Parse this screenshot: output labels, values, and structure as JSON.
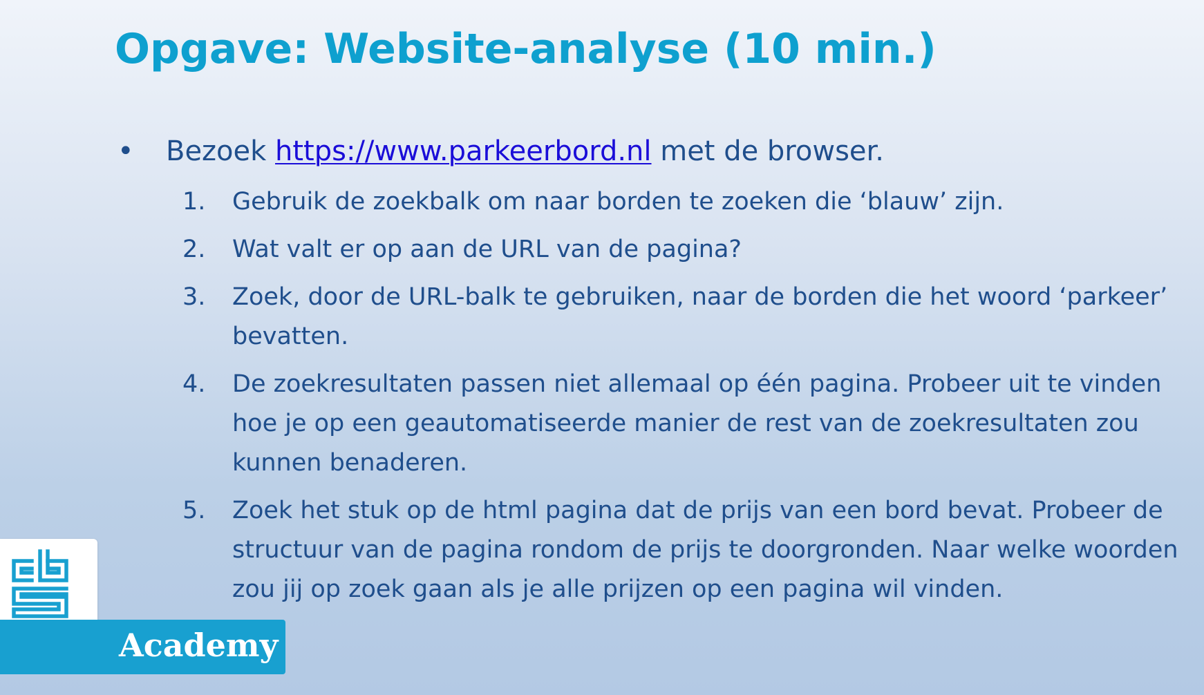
{
  "slide": {
    "title": "Opgave: Website-analyse (10 min.)"
  },
  "bullet": {
    "marker": "•",
    "prefix": "Bezoek ",
    "link": "https://www.parkeerbord.nl",
    "suffix": " met de browser."
  },
  "steps": [
    {
      "number": "1.",
      "text": "Gebruik de zoekbalk om naar borden te zoeken die ‘blauw’ zijn."
    },
    {
      "number": "2.",
      "text": "Wat valt er op aan de URL van de pagina?"
    },
    {
      "number": "3.",
      "text": "Zoek, door de URL-balk te gebruiken, naar de borden die het woord ‘parkeer’ bevatten."
    },
    {
      "number": "4.",
      "text": "De zoekresultaten passen niet allemaal op één pagina. Probeer uit te vinden hoe je op een geautomatiseerde manier de rest van de zoekresultaten zou kunnen benaderen."
    },
    {
      "number": "5.",
      "text": "Zoek het stuk op de html pagina dat de prijs van een bord bevat. Probeer de structuur van de pagina rondom de prijs te doorgronden. Naar welke woorden zou jij op zoek gaan als je alle prijzen op een pagina wil vinden."
    }
  ],
  "logo": {
    "mark": "cbs",
    "label": "Academy",
    "icon": "cbs-logo-icon"
  },
  "colors": {
    "title": "#0ea0cf",
    "body_text": "#1f4e8c",
    "link": "#1a0dd8",
    "brand": "#18a0d0"
  }
}
